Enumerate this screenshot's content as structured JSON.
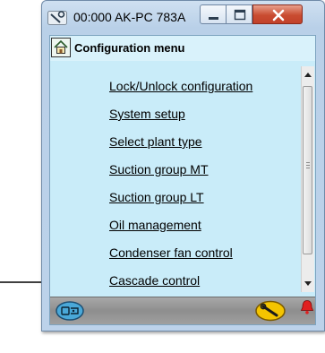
{
  "window": {
    "title": "00:000 AK-PC 783A"
  },
  "header": {
    "title": "Configuration menu"
  },
  "menu": {
    "items": [
      {
        "label": "Lock/Unlock configuration"
      },
      {
        "label": "System setup"
      },
      {
        "label": "Select plant type"
      },
      {
        "label": "Suction group MT"
      },
      {
        "label": "Suction group LT"
      },
      {
        "label": "Oil management"
      },
      {
        "label": "Condenser fan control"
      },
      {
        "label": "Cascade control"
      }
    ]
  },
  "icons": {
    "app": "wrench-plug-icon",
    "home": "home-icon",
    "status_left": "display-toggle-icon",
    "status_service": "wrench-icon",
    "status_alarm": "alarm-bell-icon"
  },
  "colors": {
    "client_background": "#c9ecf9",
    "alarm": "#e02020",
    "service_button": "#f4c400"
  }
}
